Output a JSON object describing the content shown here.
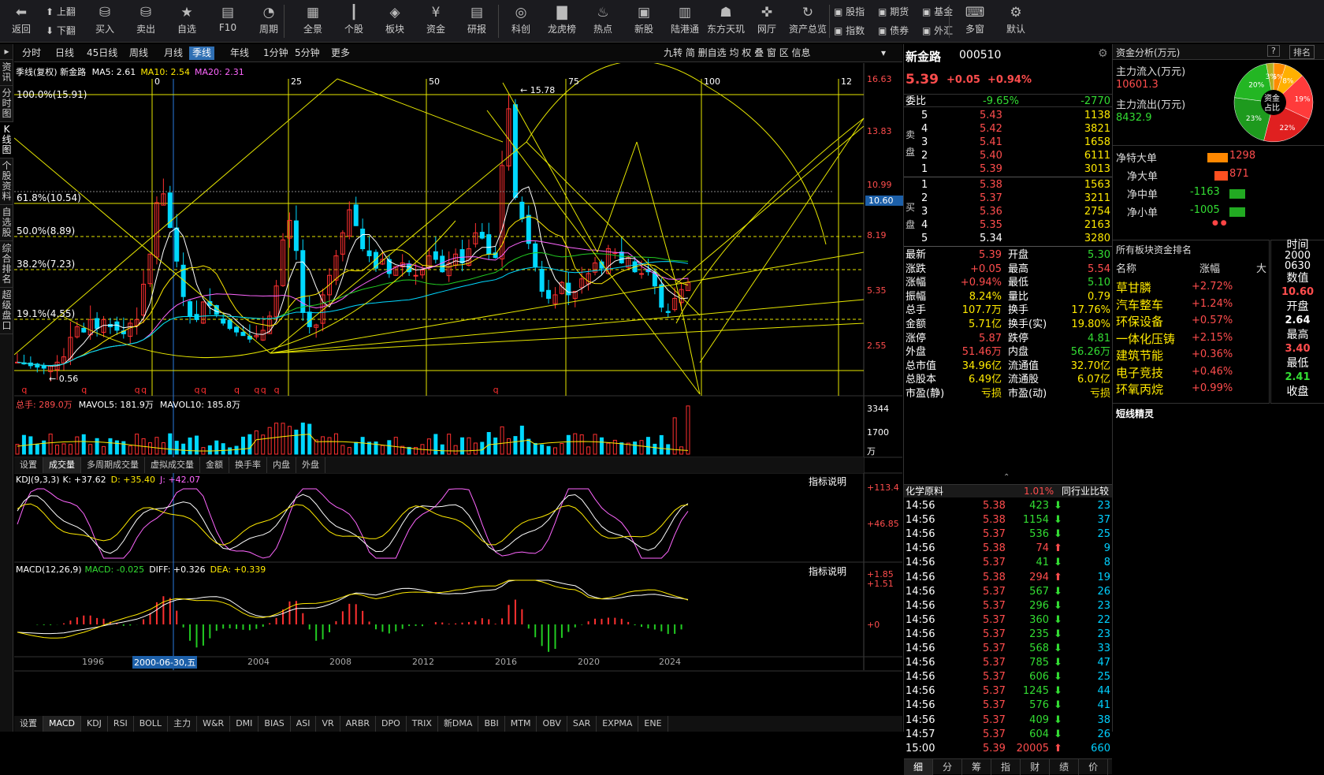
{
  "toolbar": {
    "buttons": [
      {
        "label": "返回",
        "icon": "arrow-left-icon",
        "glyph": "⬅"
      },
      {
        "label": "买入",
        "icon": "buy-icon",
        "glyph": "⛁"
      },
      {
        "label": "卖出",
        "icon": "sell-icon",
        "glyph": "⛁"
      },
      {
        "label": "自选",
        "icon": "star-icon",
        "glyph": "★"
      },
      {
        "label": "F10",
        "icon": "f10-icon",
        "glyph": "▤"
      },
      {
        "label": "周期",
        "icon": "clock-icon",
        "glyph": "◔"
      },
      {
        "label": "全景",
        "icon": "grid-icon",
        "glyph": "▦"
      },
      {
        "label": "个股",
        "icon": "candles-icon",
        "glyph": "┃"
      },
      {
        "label": "板块",
        "icon": "layers-icon",
        "glyph": "◈"
      },
      {
        "label": "资金",
        "icon": "yen-icon",
        "glyph": "¥"
      },
      {
        "label": "研报",
        "icon": "report-icon",
        "glyph": "▤"
      },
      {
        "label": "科创",
        "icon": "sci-icon",
        "glyph": "◎"
      },
      {
        "label": "龙虎榜",
        "icon": "bar-chart-icon",
        "glyph": "▇"
      },
      {
        "label": "热点",
        "icon": "flame-icon",
        "glyph": "♨"
      },
      {
        "label": "新股",
        "icon": "ipo-icon",
        "glyph": "▣"
      },
      {
        "label": "陆港通",
        "icon": "building-icon",
        "glyph": "▥"
      },
      {
        "label": "东方天玑",
        "icon": "robot-icon",
        "glyph": "☗"
      },
      {
        "label": "网厅",
        "icon": "hall-icon",
        "glyph": "✜"
      },
      {
        "label": "资产总览",
        "icon": "refresh-icon",
        "glyph": "↻"
      },
      {
        "label": "多窗",
        "icon": "keyboard-icon",
        "glyph": "⌨"
      },
      {
        "label": "默认",
        "icon": "gear-icon",
        "glyph": "⚙"
      }
    ],
    "up_label": "上翻",
    "down_label": "下翻",
    "markets": [
      "股指",
      "期货",
      "基金",
      "指数",
      "债券",
      "外汇"
    ]
  },
  "left_tabs": [
    "资讯",
    "分时图",
    "K线图",
    "个股资料",
    "自选股",
    "综合排名",
    "超级盘口"
  ],
  "periods": [
    "分时",
    "日线",
    "45日线",
    "周线",
    "月线",
    "季线",
    "年线",
    "1分钟",
    "5分钟",
    "更多"
  ],
  "period_active": "季线",
  "period_tools": "九转 简 删自选 均 权 叠 窗 区 信息",
  "chart": {
    "title": "季线(复权) 新金路",
    "ma5": "MA5: 2.61",
    "ma10": "MA10: 2.54",
    "ma20": "MA20: 2.31",
    "x_ticks": [
      "0",
      "25",
      "50",
      "75",
      "100",
      "12"
    ],
    "fib": [
      "100.0%(15.91)",
      "61.8%(10.54)",
      "50.0%(8.89)",
      "38.2%(7.23)",
      "19.1%(4.55)"
    ],
    "high_label": "15.78",
    "low_label": "0.56",
    "y_ticks": [
      "16.63",
      "13.83",
      "10.99",
      "8.19",
      "5.35",
      "2.55"
    ],
    "price_tag": "10.60",
    "vol_title": "总手: 289.0万",
    "mavol5": "MAVOL5: 181.9万",
    "mavol10": "MAVOL10: 185.8万",
    "vol_ticks": [
      "3344",
      "1700",
      "万"
    ],
    "vol_tabs": [
      "设置",
      "成交量",
      "多周期成交量",
      "虚拟成交量",
      "金额",
      "换手率",
      "内盘",
      "外盘"
    ],
    "kdj_title": "KDJ(9,3,3)",
    "kdj_k": "K: +37.62",
    "kdj_d": "D: +35.40",
    "kdj_j": "J: +42.07",
    "kdj_ticks": [
      "+113.4",
      "+46.85"
    ],
    "explain": "指标说明",
    "macd_title": "MACD(12,26,9)",
    "macd": "MACD: -0.025",
    "diff": "DIFF: +0.326",
    "dea": "DEA: +0.339",
    "macd_ticks": [
      "+1.85",
      "+1.51",
      "+0"
    ],
    "years": [
      "1996",
      "2004",
      "2008",
      "2012",
      "2016",
      "2020",
      "2024"
    ],
    "cursor_date": "2000-06-30,五",
    "indicator_tabs": [
      "设置",
      "MACD",
      "KDJ",
      "RSI",
      "BOLL",
      "主力",
      "W&R",
      "DMI",
      "BIAS",
      "ASI",
      "VR",
      "ARBR",
      "DPO",
      "TRIX",
      "新DMA",
      "BBI",
      "MTM",
      "OBV",
      "SAR",
      "EXPMA",
      "ENE"
    ]
  },
  "quote": {
    "name": "新金路",
    "code": "000510",
    "price": "5.39",
    "change": "+0.05",
    "pct": "+0.94%",
    "weibi_label": "委比",
    "weibi": "-9.65%",
    "weicha": "-2770",
    "sell_label": "卖盘",
    "buy_label": "买盘",
    "asks": [
      [
        "5",
        "5.43",
        "1138"
      ],
      [
        "4",
        "5.42",
        "3821"
      ],
      [
        "3",
        "5.41",
        "1658"
      ],
      [
        "2",
        "5.40",
        "6111"
      ],
      [
        "1",
        "5.39",
        "3013"
      ]
    ],
    "bids": [
      [
        "1",
        "5.38",
        "1563"
      ],
      [
        "2",
        "5.37",
        "3211"
      ],
      [
        "3",
        "5.36",
        "2754"
      ],
      [
        "4",
        "5.35",
        "2163"
      ],
      [
        "5",
        "5.34",
        "3280"
      ]
    ],
    "stats": [
      [
        "最新",
        "5.39",
        "开盘",
        "5.30"
      ],
      [
        "涨跌",
        "+0.05",
        "最高",
        "5.54"
      ],
      [
        "涨幅",
        "+0.94%",
        "最低",
        "5.10"
      ],
      [
        "振幅",
        "8.24%",
        "量比",
        "0.79"
      ],
      [
        "总手",
        "107.7万",
        "换手",
        "17.76%"
      ],
      [
        "金额",
        "5.71亿",
        "换手(实)",
        "19.80%"
      ],
      [
        "涨停",
        "5.87",
        "跌停",
        "4.81"
      ],
      [
        "外盘",
        "51.46万",
        "内盘",
        "56.26万"
      ],
      [
        "总市值",
        "34.96亿",
        "流通值",
        "32.70亿"
      ],
      [
        "总股本",
        "6.49亿",
        "流通股",
        "6.07亿"
      ],
      [
        "市盈(静)",
        "亏损",
        "市盈(动)",
        "亏损"
      ]
    ],
    "industry": "化学原料",
    "industry_pct": "1.01%",
    "industry_cmp": "同行业比较",
    "ticks": [
      [
        "14:56",
        "5.38",
        "423",
        "23"
      ],
      [
        "14:56",
        "5.38",
        "1154",
        "37"
      ],
      [
        "14:56",
        "5.37",
        "536",
        "25"
      ],
      [
        "14:56",
        "5.38",
        "74",
        "9"
      ],
      [
        "14:56",
        "5.37",
        "41",
        "8"
      ],
      [
        "14:56",
        "5.38",
        "294",
        "19"
      ],
      [
        "14:56",
        "5.37",
        "567",
        "26"
      ],
      [
        "14:56",
        "5.37",
        "296",
        "23"
      ],
      [
        "14:56",
        "5.37",
        "360",
        "22"
      ],
      [
        "14:56",
        "5.37",
        "235",
        "23"
      ],
      [
        "14:56",
        "5.37",
        "568",
        "33"
      ],
      [
        "14:56",
        "5.37",
        "785",
        "47"
      ],
      [
        "14:56",
        "5.37",
        "606",
        "25"
      ],
      [
        "14:56",
        "5.37",
        "1245",
        "44"
      ],
      [
        "14:56",
        "5.37",
        "576",
        "41"
      ],
      [
        "14:56",
        "5.37",
        "409",
        "38"
      ],
      [
        "14:57",
        "5.37",
        "604",
        "26"
      ],
      [
        "15:00",
        "5.39",
        "20005",
        "660"
      ]
    ],
    "tick_dirs": [
      "down",
      "down",
      "down",
      "up",
      "down",
      "up",
      "down",
      "down",
      "down",
      "down",
      "down",
      "down",
      "down",
      "down",
      "down",
      "down",
      "down",
      "up"
    ],
    "bottom_tabs": [
      "细",
      "分",
      "筹",
      "指",
      "财",
      "绩",
      "价"
    ]
  },
  "fund": {
    "title": "资金分析(万元)",
    "tab": "排名",
    "help": "?",
    "in_label": "主力流入(万元)",
    "in_value": "10601.3",
    "out_label": "主力流出(万元)",
    "out_value": "8432.9",
    "pie_center": "资金占比",
    "pie": [
      {
        "label": "5%",
        "v": 5,
        "c": "#ff8c00"
      },
      {
        "label": "8%",
        "v": 8,
        "c": "#ffb000"
      },
      {
        "label": "19%",
        "v": 19,
        "c": "#ff3b3b"
      },
      {
        "label": "22%",
        "v": 22,
        "c": "#e02020"
      },
      {
        "label": "23%",
        "v": 23,
        "c": "#1e9a1e"
      },
      {
        "label": "20%",
        "v": 20,
        "c": "#23b623"
      },
      {
        "label": "3%",
        "v": 3,
        "c": "#b0b020"
      }
    ],
    "flows": [
      [
        "净特大单",
        "1298",
        1298
      ],
      [
        "净大单",
        "871",
        871
      ],
      [
        "净中单",
        "-1163",
        -1163
      ],
      [
        "净小单",
        "-1005",
        -1005
      ]
    ],
    "rank_title": "所有板块资金排名",
    "rank_headers": [
      "名称",
      "涨幅",
      "大"
    ],
    "rank": [
      [
        "草甘膦",
        "+2.72%"
      ],
      [
        "汽车整车",
        "+1.24%"
      ],
      [
        "环保设备",
        "+0.57%"
      ],
      [
        "一体化压铸",
        "+2.15%"
      ],
      [
        "建筑节能",
        "+0.36%"
      ],
      [
        "电子竞技",
        "+0.46%"
      ],
      [
        "环氧丙烷",
        "+0.99%"
      ]
    ],
    "side": [
      "时间",
      "2000",
      "0630",
      "数值",
      "10.60",
      "开盘",
      "2.64",
      "最高",
      "3.40",
      "最低",
      "2.41",
      "收盘"
    ],
    "short_title": "短线精灵"
  }
}
